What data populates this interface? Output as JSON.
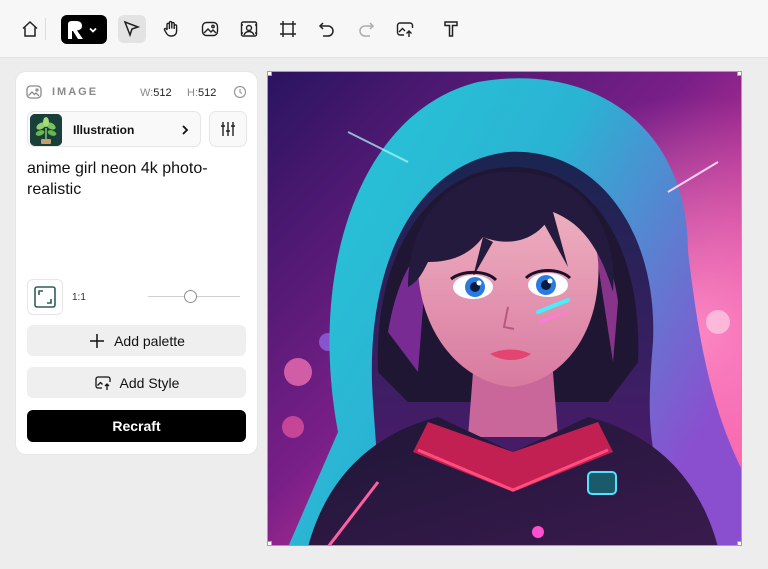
{
  "toolbar": {
    "items": [
      "home-icon",
      "logo-menu",
      "select-tool",
      "hand-tool",
      "image-tool",
      "face-tool",
      "frame-tool",
      "undo",
      "redo",
      "upscale-tool",
      "text-tool"
    ]
  },
  "panel": {
    "title": "IMAGE",
    "width_label": "W:",
    "width_value": "512",
    "height_label": "H:",
    "height_value": "512",
    "style_name": "Illustration",
    "prompt": "anime girl neon 4k photo-realistic",
    "ratio": "1:1",
    "ratio_slider_level": 0.42,
    "add_palette": "Add palette",
    "add_style": "Add Style",
    "recraft": "Recraft"
  },
  "colors": {
    "selection": "#f08a3c",
    "button_dark": "#000000",
    "button_light": "#efefef"
  }
}
